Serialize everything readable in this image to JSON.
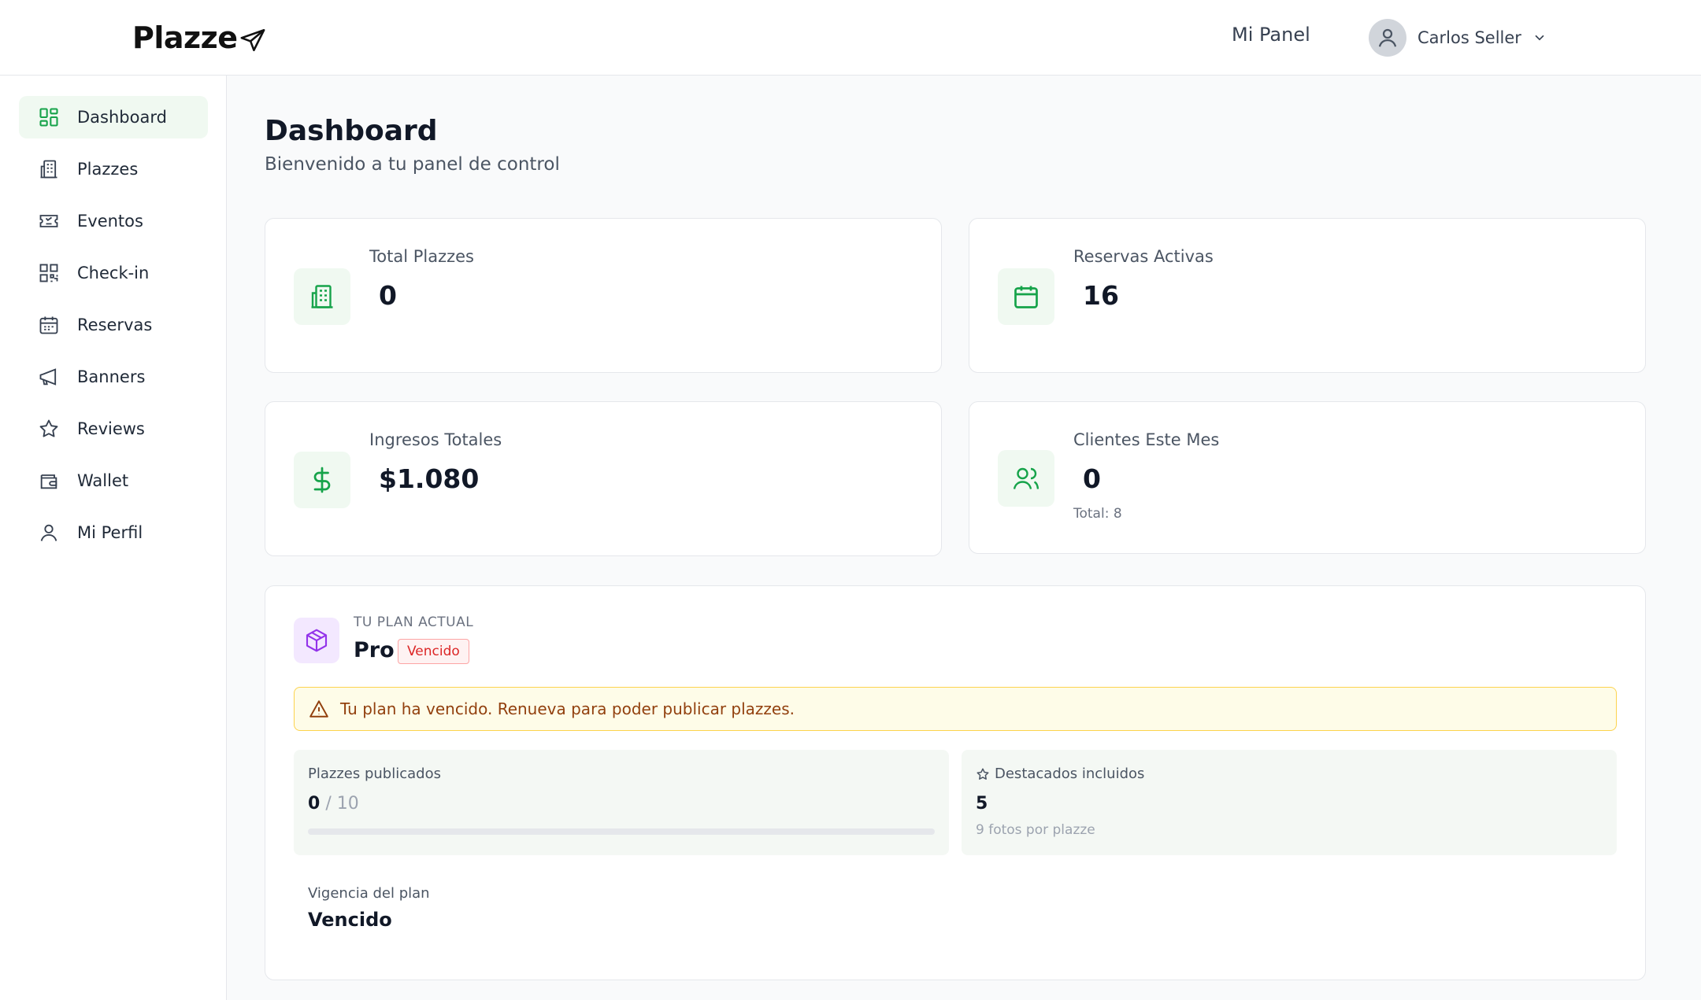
{
  "header": {
    "logo": "Plazze",
    "nav_label": "Mi Panel",
    "user_name": "Carlos Seller"
  },
  "sidebar": {
    "items": [
      {
        "label": "Dashboard",
        "icon": "dashboard-grid-icon",
        "active": true
      },
      {
        "label": "Plazzes",
        "icon": "building-icon"
      },
      {
        "label": "Eventos",
        "icon": "ticket-icon"
      },
      {
        "label": "Check-in",
        "icon": "qr-code-icon"
      },
      {
        "label": "Reservas",
        "icon": "calendar-icon"
      },
      {
        "label": "Banners",
        "icon": "megaphone-icon"
      },
      {
        "label": "Reviews",
        "icon": "star-icon"
      },
      {
        "label": "Wallet",
        "icon": "wallet-icon"
      },
      {
        "label": "Mi Perfil",
        "icon": "user-icon"
      }
    ]
  },
  "page": {
    "title": "Dashboard",
    "subtitle": "Bienvenido a tu panel de control"
  },
  "stats": [
    {
      "label": "Total Plazzes",
      "value": "0",
      "icon": "building-icon"
    },
    {
      "label": "Reservas Activas",
      "value": "16",
      "icon": "calendar-icon"
    },
    {
      "label": "Ingresos Totales",
      "value": "$1.080",
      "icon": "dollar-icon"
    },
    {
      "label": "Clientes Este Mes",
      "value": "0",
      "icon": "users-icon",
      "note": "Total: 8"
    }
  ],
  "plan": {
    "kicker": "TU PLAN ACTUAL",
    "name": "Pro",
    "badge": "Vencido",
    "alert": "Tu plan ha vencido. Renueva para poder publicar plazzes.",
    "published_label": "Plazzes publicados",
    "published_count": "0",
    "published_limit": "/ 10",
    "published_fraction": 0,
    "featured_label": "Destacados incluidos",
    "featured_value": "5",
    "featured_note": "9 fotos por plazze",
    "validity_label": "Vigencia del plan",
    "validity_value": "Vencido"
  },
  "colors": {
    "accent_green": "#16a34a",
    "icon_bg_green": "#f0f9f1",
    "plan_purple": "#9333ea",
    "alert_amber": "#92400e",
    "badge_red": "#dc2626"
  }
}
